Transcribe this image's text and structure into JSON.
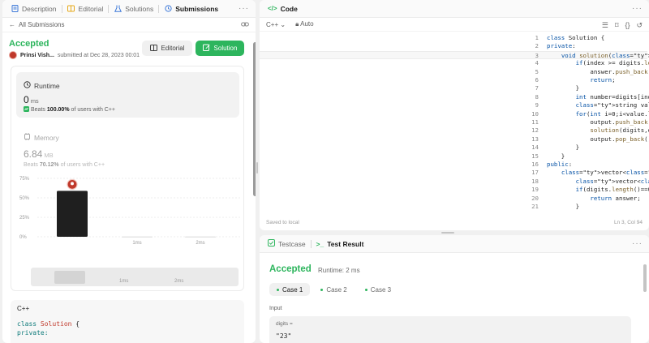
{
  "left_tabs": [
    {
      "label": "Description",
      "icon": "document-icon"
    },
    {
      "label": "Editorial",
      "icon": "book-icon"
    },
    {
      "label": "Solutions",
      "icon": "flask-icon"
    },
    {
      "label": "Submissions",
      "icon": "history-icon"
    }
  ],
  "back_label": "All Submissions",
  "submission": {
    "status": "Accepted",
    "author": "Prinsi Vish...",
    "submitted_text": "submitted at Dec 28, 2023 00:01",
    "editorial_btn": "Editorial",
    "solution_btn": "Solution"
  },
  "runtime": {
    "title": "Runtime",
    "value": "0",
    "unit": "ms",
    "beats_prefix": "Beats",
    "beats_pct": "100.00%",
    "beats_suffix": "of users with C++"
  },
  "memory": {
    "title": "Memory",
    "value": "6.84",
    "unit": "MB",
    "beats_prefix": "Beats",
    "beats_pct": "70.12%",
    "beats_suffix": "of users with C++"
  },
  "chart_data": {
    "type": "bar",
    "y_ticks": [
      "75%",
      "50%",
      "25%",
      "0%"
    ],
    "ylim": [
      0,
      75
    ],
    "categories": [
      "0ms",
      "1ms",
      "2ms"
    ],
    "x_labels_shown": [
      "1ms",
      "2ms"
    ],
    "values": [
      59,
      0.5,
      0.5
    ],
    "highlight_index": 0
  },
  "overview_labels": [
    "1ms",
    "2ms"
  ],
  "submitted_code": {
    "language": "C++",
    "lines": [
      "class Solution {",
      "private:"
    ]
  },
  "code_panel": {
    "title": "Code",
    "language": "C++",
    "mode": "Auto",
    "saved_text": "Saved to local",
    "cursor_text": "Ln 3, Col 94",
    "lines": [
      "class Solution {",
      "private:",
      "    void solution(string digits,string output,int index,vector<string>&answer,string mapping[]){",
      "        if(index >= digits.length()){",
      "            answer.push_back(output);",
      "            return;",
      "        }",
      "        int number=digits[index]-'0';",
      "        string value =mapping[number];",
      "        for(int i=0;i<value.length();i++){",
      "            output.push_back(value[i]);",
      "            solution(digits,output,index + 1,answer,mapping);",
      "            output.pop_back();",
      "        }",
      "    }",
      "public:",
      "    vector<string> letterCombinations(string digits) {",
      "        vector<string>answer;",
      "        if(digits.length()==0){",
      "            return answer;",
      "        }"
    ]
  },
  "test_panel": {
    "testcase_tab": "Testcase",
    "result_tab": "Test Result",
    "status": "Accepted",
    "runtime": "Runtime: 2 ms",
    "cases": [
      "Case 1",
      "Case 2",
      "Case 3"
    ],
    "input_label": "Input",
    "param_name": "digits =",
    "param_value": "\"23\""
  },
  "colors": {
    "accent_green": "#2db55d",
    "bar_dark": "#1f1f1f",
    "avatar_red": "#c0392b"
  }
}
